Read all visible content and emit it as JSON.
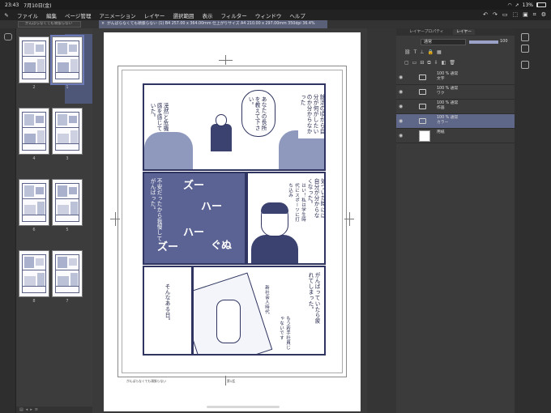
{
  "status": {
    "time": "23:43",
    "date": "7月10日(金)",
    "battery": "13%",
    "battery_level": 0.13
  },
  "menu": [
    "ファイル",
    "編集",
    "ページ管理",
    "アニメーション",
    "レイヤー",
    "選択範囲",
    "表示",
    "フィルター",
    "ウィンドウ",
    "ヘルプ"
  ],
  "tabs": {
    "page_manager": "がんばらなくても頑張らない",
    "document": "がんばらなくても頑張らない (1) B4 257.00 x 364.00mm 仕上がりサイズ A4 210.00 x 297.00mm 350dpi 36.4%"
  },
  "thumbnails": [
    {
      "label": "2",
      "selected": false
    },
    {
      "label": "1",
      "selected": true
    },
    {
      "label": "4",
      "selected": false
    },
    {
      "label": "3",
      "selected": false
    },
    {
      "label": "6",
      "selected": false
    },
    {
      "label": "5",
      "selected": false
    },
    {
      "label": "8",
      "selected": false
    },
    {
      "label": "7",
      "selected": false
    }
  ],
  "page": {
    "speech1": "あなたの長所を教えて下さい。",
    "caption1": "漠然と危機感を感じていた。",
    "caption2": "就活の頃から自分が何がしたいのか分からなかった",
    "caption3": "不安だったから我慢してがんばった。",
    "sfx1": "ズー",
    "sfx2": "ハー",
    "sfx3": "ハー",
    "sfx4": "ズー",
    "sfx5": "ぐぬ",
    "caption4": "気づいた時には自分が分からなくなった。",
    "thought": "はい！私は学生時代にスポーツに打ち込み",
    "caption5": "そんなある日。",
    "caption6": "がんばっていたら疲れてしまった。",
    "caption7": "新社会人時代",
    "caption8": "もう若手社員じゃないです",
    "footer_left": "がんばらなくても頑張らない",
    "footer_center": "第1話"
  },
  "layers": {
    "tabs": [
      "レイヤープロパティ",
      "レイヤー"
    ],
    "blend": "通常",
    "opacity": "100",
    "opacity_level": 1.0,
    "items": [
      {
        "mode": "100 % 通常",
        "name": "文字",
        "selected": false,
        "type": "folder"
      },
      {
        "mode": "100 % 通常",
        "name": "ワク",
        "selected": false,
        "type": "folder"
      },
      {
        "mode": "100 % 通常",
        "name": "作画",
        "selected": false,
        "type": "folder"
      },
      {
        "mode": "100 % 通常",
        "name": "カラー",
        "selected": true,
        "type": "folder"
      },
      {
        "mode": "",
        "name": "用紙",
        "selected": false,
        "type": "paper"
      }
    ]
  }
}
